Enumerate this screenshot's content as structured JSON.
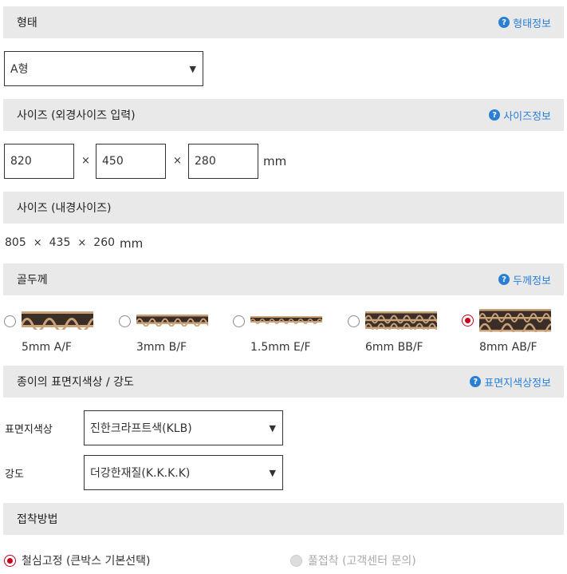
{
  "shape": {
    "title": "형태",
    "info_label": "형태정보",
    "select_value": "A형"
  },
  "outer_size": {
    "title": "사이즈 (외경사이즈 입력)",
    "info_label": "사이즈정보",
    "width": "820",
    "depth": "450",
    "height": "280",
    "times": "×",
    "unit": "mm"
  },
  "inner_size": {
    "title": "사이즈 (내경사이즈)",
    "width": "805",
    "depth": "435",
    "height": "260",
    "times": "×",
    "unit": "mm"
  },
  "flute": {
    "title": "골두께",
    "info_label": "두께정보",
    "options": [
      {
        "label": "5mm A/F",
        "checked": false
      },
      {
        "label": "3mm B/F",
        "checked": false
      },
      {
        "label": "1.5mm E/F",
        "checked": false
      },
      {
        "label": "6mm BB/F",
        "checked": false
      },
      {
        "label": "8mm AB/F",
        "checked": true
      }
    ]
  },
  "paper": {
    "title": "종이의 표면지색상 / 강도",
    "info_label": "표면지색상정보",
    "color_label": "표면지색상",
    "color_value": "진한크라프트색(KLB)",
    "strength_label": "강도",
    "strength_value": "더강한재질(K.K.K.K)"
  },
  "glue": {
    "title": "접착방법",
    "options": [
      {
        "label": "철심고정 (큰박스 기본선택)",
        "checked": true,
        "disabled": false
      },
      {
        "label": "풀접착 (고객센터 문의)",
        "checked": false,
        "disabled": true
      }
    ]
  },
  "icons": {
    "info": "?",
    "arrow": "▼"
  },
  "colors": {
    "header_bg": "#e9e9e9",
    "link": "#2a7fd4",
    "radio_checked": "#c4001a",
    "flute_kraft": "#c9a27a",
    "flute_dark": "#3b2e26"
  }
}
